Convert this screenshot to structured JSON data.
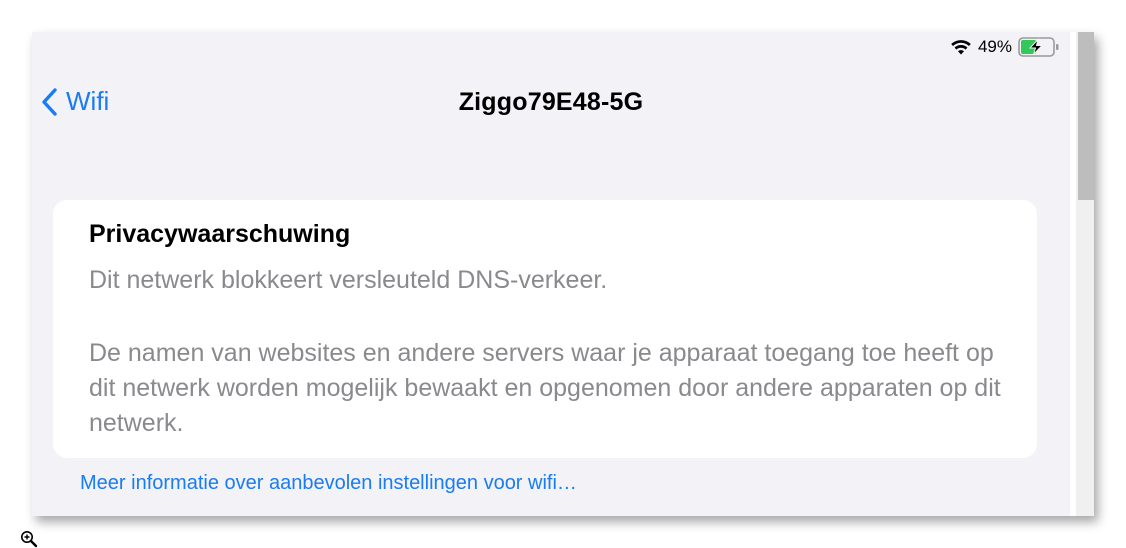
{
  "status_bar": {
    "battery_percent": "49%",
    "wifi_icon": "wifi-icon",
    "battery_icon": "battery-charging-icon",
    "battery_level": 0.49,
    "battery_color": "#34c759"
  },
  "nav": {
    "back_label": "Wifi",
    "back_icon": "chevron-left-icon",
    "title": "Ziggo79E48-5G"
  },
  "card": {
    "title": "Privacywaarschuwing",
    "subtitle": "Dit netwerk blokkeert versleuteld DNS-verkeer.",
    "body": "De namen van websites en andere servers waar je apparaat toegang toe heeft op dit netwerk worden mogelijk bewaakt en opgenomen door andere apparaten op dit netwerk."
  },
  "footer": {
    "link_label": "Meer informatie over aanbevolen instellingen voor wifi…"
  },
  "colors": {
    "accent": "#1a7cf2",
    "background": "#f2f2f7",
    "secondary_text": "#8a8a8e"
  }
}
